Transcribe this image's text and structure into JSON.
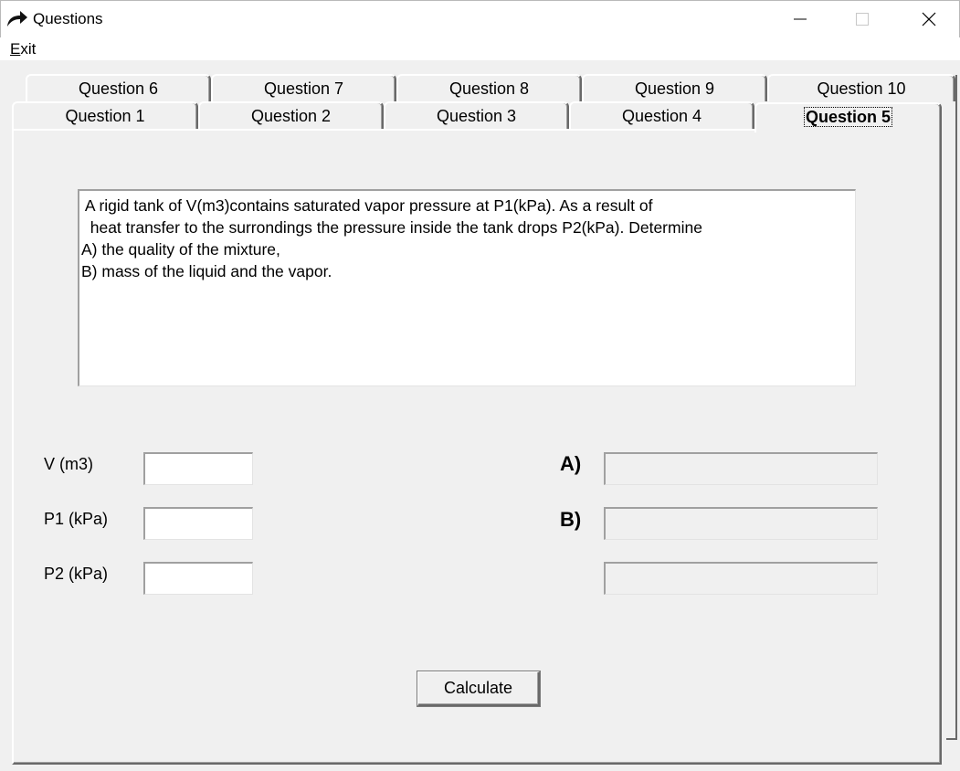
{
  "window": {
    "title": "Questions",
    "icon": "curved-arrow-icon",
    "controls": {
      "minimize": "—",
      "maximize": "☐",
      "close": "✕"
    }
  },
  "menu": {
    "exit_first": "E",
    "exit_rest": "xit"
  },
  "tabs": {
    "back_row": [
      "Question 6",
      "Question 7",
      "Question 8",
      "Question 9",
      "Question 10"
    ],
    "front_row": [
      "Question 1",
      "Question 2",
      "Question 3",
      "Question 4",
      "Question 5"
    ],
    "active": "Question 5"
  },
  "question": {
    "lines": [
      " A rigid tank of V(m3)contains saturated vapor pressure at P1(kPa). As a result of",
      "  heat transfer to the surrondings the pressure inside the tank drops P2(kPa). Determine",
      "A) the quality of the mixture,",
      "B) mass of the liquid and the vapor."
    ]
  },
  "inputs": [
    {
      "label": "V (m3)",
      "value": ""
    },
    {
      "label": "P1 (kPa)",
      "value": ""
    },
    {
      "label": "P2 (kPa)",
      "value": ""
    }
  ],
  "outputs": [
    {
      "label": "A)",
      "value": ""
    },
    {
      "label": "B)",
      "value": ""
    },
    {
      "label": "",
      "value": ""
    }
  ],
  "calculate_label": "Calculate"
}
